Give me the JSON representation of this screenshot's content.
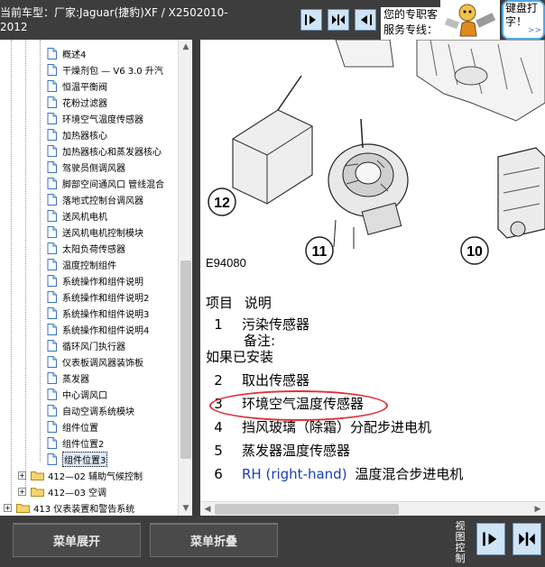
{
  "header": {
    "car_model_line1": "当前车型：厂家:Jaguar(捷豹)XF / X2502010-",
    "car_model_line2": "2012",
    "hotline_line1": "您的专职客",
    "hotline_line2": "服务专线：",
    "bubble_line1": "键盘打",
    "bubble_line2": "字！",
    "bubble_more": ">>"
  },
  "tree": {
    "items": [
      {
        "label": "概述4"
      },
      {
        "label": "干燥剂包 — V6 3.0 升汽"
      },
      {
        "label": "恒温平衡阀"
      },
      {
        "label": "花粉过滤器"
      },
      {
        "label": "环境空气温度传感器"
      },
      {
        "label": "加热器核心"
      },
      {
        "label": "加热器核心和蒸发器核心"
      },
      {
        "label": "驾驶员侧调风器"
      },
      {
        "label": "脚部空间通风口 管线混合"
      },
      {
        "label": "落地式控制台调风器"
      },
      {
        "label": "送风机电机"
      },
      {
        "label": "送风机电机控制模块"
      },
      {
        "label": "太阳负荷传感器"
      },
      {
        "label": "温度控制组件"
      },
      {
        "label": "系统操作和组件说明"
      },
      {
        "label": "系统操作和组件说明2"
      },
      {
        "label": "系统操作和组件说明3"
      },
      {
        "label": "系统操作和组件说明4"
      },
      {
        "label": "循环风门执行器"
      },
      {
        "label": "仪表板调风器装饰板"
      },
      {
        "label": "蒸发器"
      },
      {
        "label": "中心调风口"
      },
      {
        "label": "自动空调系统模块"
      },
      {
        "label": "组件位置"
      },
      {
        "label": "组件位置2"
      },
      {
        "label": "组件位置3"
      }
    ],
    "folders": [
      {
        "label": "412—02 辅助气候控制"
      },
      {
        "label": "412—03 空调"
      },
      {
        "label": "413 仪表装置和警告系统"
      }
    ]
  },
  "diagram": {
    "figure_id": "E94080",
    "callouts": [
      "12",
      "11",
      "10"
    ]
  },
  "legend": {
    "header_item": "项目",
    "header_desc": "说明",
    "rows": [
      {
        "num": "1",
        "text": "污染传感器"
      },
      {
        "num": "",
        "text": "备注:"
      },
      {
        "num": "",
        "text": "如果已安装"
      },
      {
        "num": "2",
        "text": "取出传感器"
      },
      {
        "num": "3",
        "text": "环境空气温度传感器"
      },
      {
        "num": "4",
        "text": "挡风玻璃（除霜）分配步进电机"
      },
      {
        "num": "5",
        "text": "蒸发器温度传感器"
      },
      {
        "num": "6",
        "text_blue": "RH (right-hand)",
        "text": "温度混合步进电机"
      }
    ]
  },
  "footer": {
    "expand_label": "菜单展开",
    "collapse_label": "菜单折叠",
    "view_control_label": "视图控制"
  }
}
